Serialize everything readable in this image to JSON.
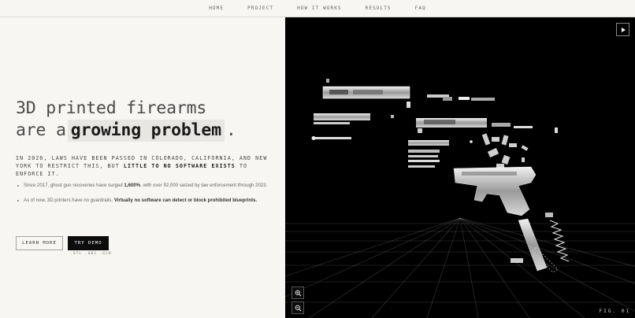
{
  "nav": {
    "items": [
      {
        "label": "HOME"
      },
      {
        "label": "PROJECT"
      },
      {
        "label": "HOW IT WORKS"
      },
      {
        "label": "RESULTS"
      },
      {
        "label": "FAQ"
      }
    ]
  },
  "hero": {
    "headline_line1": "3D printed firearms",
    "headline_line2_prefix": "are a",
    "headline_highlight": "growing problem",
    "headline_suffix": ".",
    "lead_text": "IN 2026, LAWS HAVE BEEN PASSED IN COLORADO, CALIFORNIA, AND NEW YORK TO RESTRICT THIS, BUT",
    "lead_strong": "LITTLE TO NO SOFTWARE EXISTS",
    "lead_tail": "TO ENFORCE IT.",
    "bullets": [
      {
        "text_before": "Since 2017, ghost gun recoveries have surged",
        "strong": "1,600%",
        "text_after": ", with over 92,000 seized by law enforcement through 2023."
      },
      {
        "text_before": "As of now, 3D printers have no guardrails.",
        "strong": "Virtually no software can detect or block prohibited blueprints.",
        "text_after": ""
      }
    ],
    "learn_more_label": "LEARN MORE",
    "try_demo_label": "TRY DEMO",
    "formats": ".STL .OBJ .GLB"
  },
  "viewer": {
    "fig_label": "FIG. 01",
    "play_icon": "play-icon",
    "zoom_in_icon": "zoom-in-icon",
    "zoom_out_icon": "zoom-out-icon",
    "background": "#000000",
    "grid_color": "#ffffff"
  }
}
